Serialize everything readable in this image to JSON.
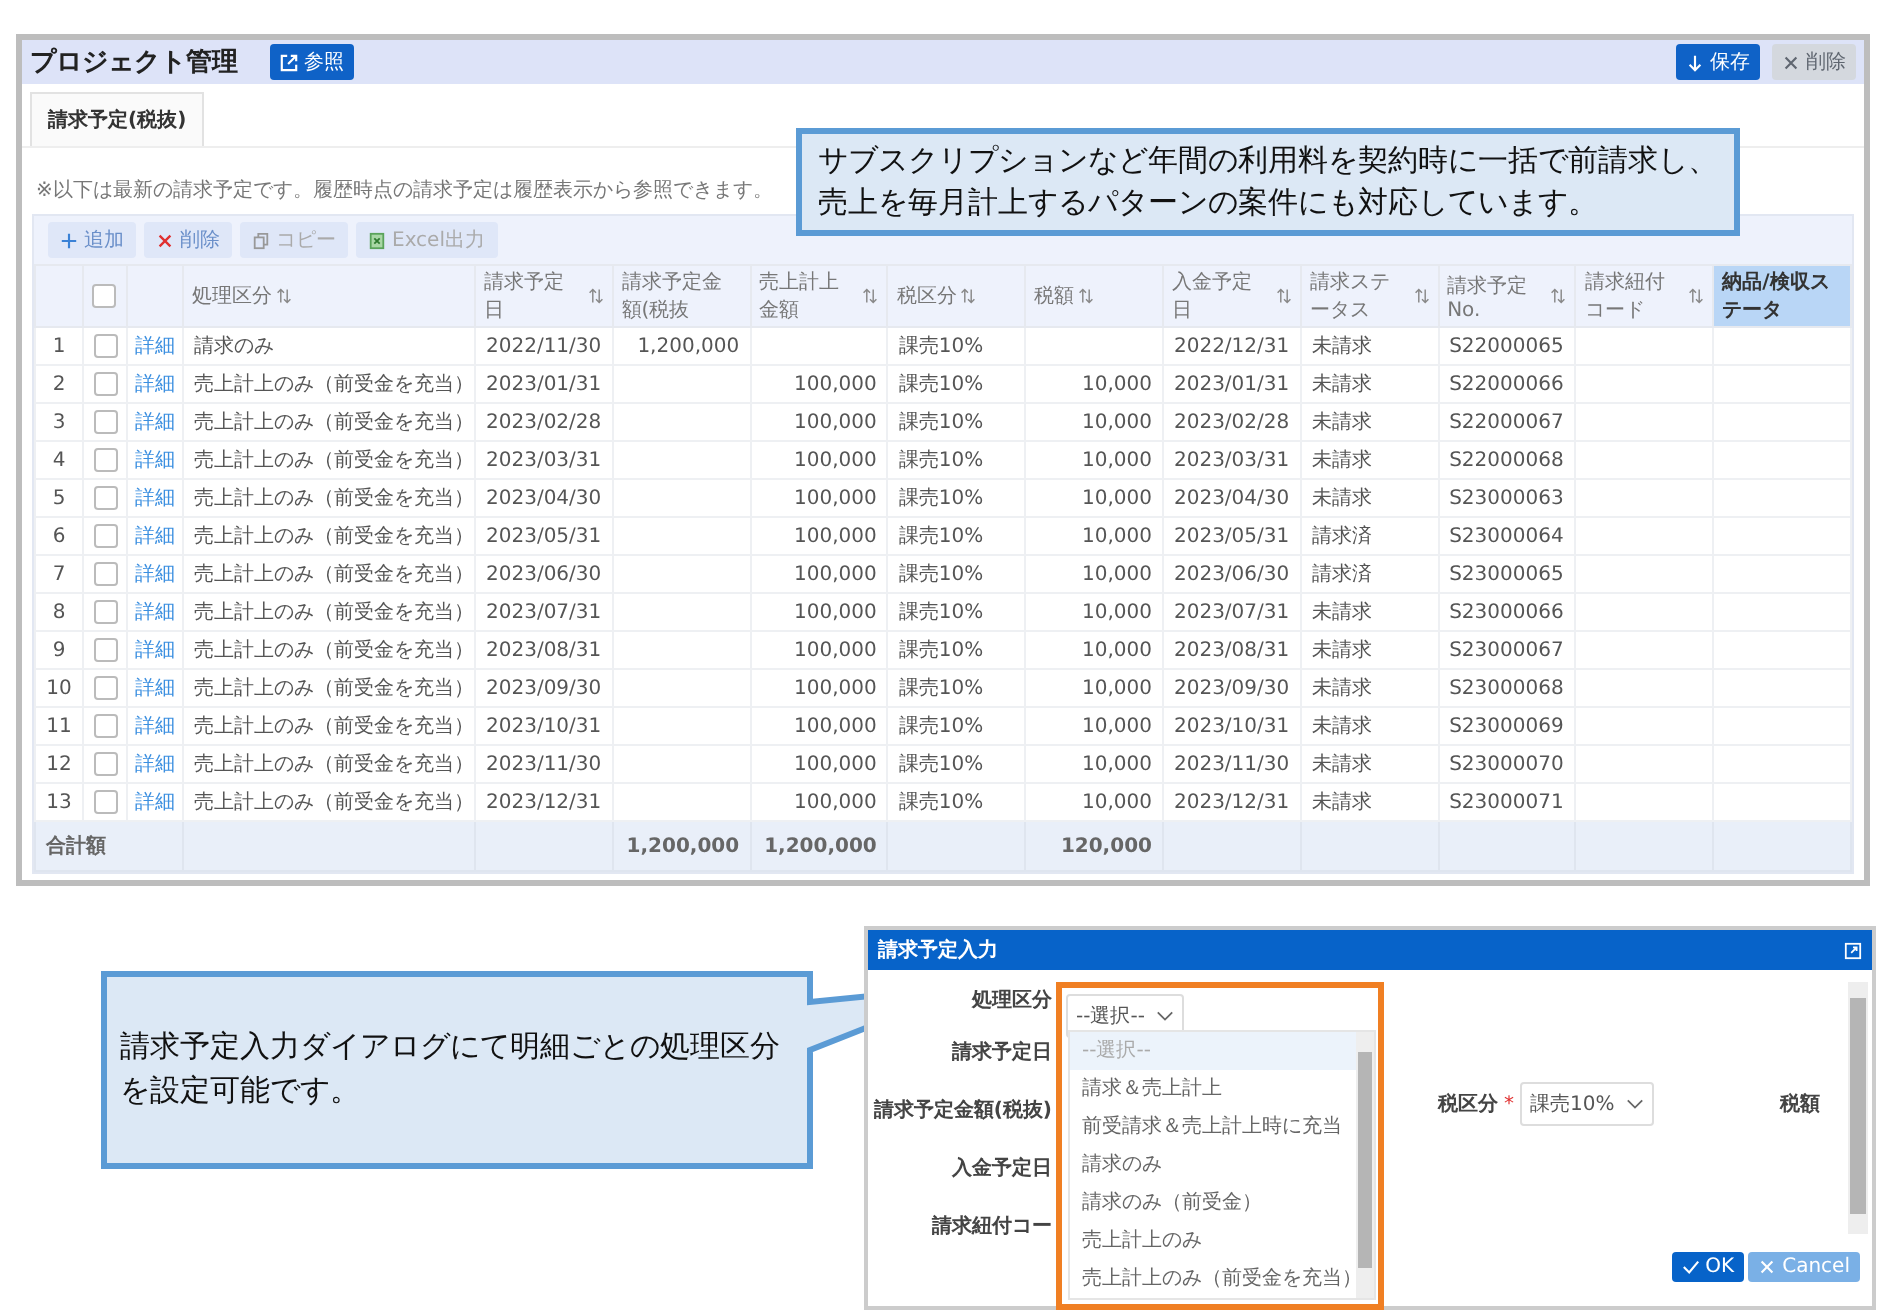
{
  "app": {
    "title": "プロジェクト管理",
    "reference_button": "参照",
    "save_button": "保存",
    "delete_button": {
      "label": "削除",
      "disabled": true
    }
  },
  "tabs": [
    {
      "label": "請求予定(税抜)",
      "selected": true
    }
  ],
  "note": "※以下は最新の請求予定です。履歴時点の請求予定は履歴表示から参照できます。",
  "toolbar": [
    {
      "kind": "add",
      "label": "追加",
      "disabled": false
    },
    {
      "kind": "delete",
      "label": "削除",
      "disabled": false
    },
    {
      "kind": "copy",
      "label": "コピー",
      "disabled": true
    },
    {
      "kind": "excel",
      "label": "Excel出力",
      "disabled": true
    }
  ],
  "table": {
    "header_checkbox": {
      "checked": false
    },
    "columns": [
      {
        "label": "処理区分",
        "sortable": true,
        "highlighted": false
      },
      {
        "label": "請求予定日",
        "sortable": true,
        "highlighted": false
      },
      {
        "label": "請求予定金額(税抜",
        "sortable": false,
        "highlighted": false
      },
      {
        "label": "売上計上金額",
        "sortable": true,
        "highlighted": false
      },
      {
        "label": "税区分",
        "sortable": true,
        "highlighted": false
      },
      {
        "label": "税額",
        "sortable": true,
        "highlighted": false
      },
      {
        "label": "入金予定日",
        "sortable": true,
        "highlighted": false
      },
      {
        "label": "請求ステータス",
        "sortable": true,
        "highlighted": false
      },
      {
        "label": "請求予定No.",
        "sortable": true,
        "highlighted": false
      },
      {
        "label": "請求紐付コード",
        "sortable": true,
        "highlighted": false
      },
      {
        "label": "納品/検収ステータ",
        "sortable": false,
        "highlighted": true
      }
    ],
    "rows": [
      {
        "no": "1",
        "checked": false,
        "link": "詳細",
        "cells": [
          "請求のみ",
          "2022/11/30",
          "1,200,000",
          "",
          "課売10%",
          "",
          "2022/12/31",
          "未請求",
          "S22000065",
          "",
          ""
        ]
      },
      {
        "no": "2",
        "checked": false,
        "link": "詳細",
        "cells": [
          "売上計上のみ（前受金を充当）",
          "2023/01/31",
          "",
          "100,000",
          "課売10%",
          "10,000",
          "2023/01/31",
          "未請求",
          "S22000066",
          "",
          ""
        ]
      },
      {
        "no": "3",
        "checked": false,
        "link": "詳細",
        "cells": [
          "売上計上のみ（前受金を充当）",
          "2023/02/28",
          "",
          "100,000",
          "課売10%",
          "10,000",
          "2023/02/28",
          "未請求",
          "S22000067",
          "",
          ""
        ]
      },
      {
        "no": "4",
        "checked": false,
        "link": "詳細",
        "cells": [
          "売上計上のみ（前受金を充当）",
          "2023/03/31",
          "",
          "100,000",
          "課売10%",
          "10,000",
          "2023/03/31",
          "未請求",
          "S22000068",
          "",
          ""
        ]
      },
      {
        "no": "5",
        "checked": false,
        "link": "詳細",
        "cells": [
          "売上計上のみ（前受金を充当）",
          "2023/04/30",
          "",
          "100,000",
          "課売10%",
          "10,000",
          "2023/04/30",
          "未請求",
          "S23000063",
          "",
          ""
        ]
      },
      {
        "no": "6",
        "checked": false,
        "link": "詳細",
        "cells": [
          "売上計上のみ（前受金を充当）",
          "2023/05/31",
          "",
          "100,000",
          "課売10%",
          "10,000",
          "2023/05/31",
          "請求済",
          "S23000064",
          "",
          ""
        ]
      },
      {
        "no": "7",
        "checked": false,
        "link": "詳細",
        "cells": [
          "売上計上のみ（前受金を充当）",
          "2023/06/30",
          "",
          "100,000",
          "課売10%",
          "10,000",
          "2023/06/30",
          "請求済",
          "S23000065",
          "",
          ""
        ]
      },
      {
        "no": "8",
        "checked": false,
        "link": "詳細",
        "cells": [
          "売上計上のみ（前受金を充当）",
          "2023/07/31",
          "",
          "100,000",
          "課売10%",
          "10,000",
          "2023/07/31",
          "未請求",
          "S23000066",
          "",
          ""
        ]
      },
      {
        "no": "9",
        "checked": false,
        "link": "詳細",
        "cells": [
          "売上計上のみ（前受金を充当）",
          "2023/08/31",
          "",
          "100,000",
          "課売10%",
          "10,000",
          "2023/08/31",
          "未請求",
          "S23000067",
          "",
          ""
        ]
      },
      {
        "no": "10",
        "checked": false,
        "link": "詳細",
        "cells": [
          "売上計上のみ（前受金を充当）",
          "2023/09/30",
          "",
          "100,000",
          "課売10%",
          "10,000",
          "2023/09/30",
          "未請求",
          "S23000068",
          "",
          ""
        ]
      },
      {
        "no": "11",
        "checked": false,
        "link": "詳細",
        "cells": [
          "売上計上のみ（前受金を充当）",
          "2023/10/31",
          "",
          "100,000",
          "課売10%",
          "10,000",
          "2023/10/31",
          "未請求",
          "S23000069",
          "",
          ""
        ]
      },
      {
        "no": "12",
        "checked": false,
        "link": "詳細",
        "cells": [
          "売上計上のみ（前受金を充当）",
          "2023/11/30",
          "",
          "100,000",
          "課売10%",
          "10,000",
          "2023/11/30",
          "未請求",
          "S23000070",
          "",
          ""
        ]
      },
      {
        "no": "13",
        "checked": false,
        "link": "詳細",
        "cells": [
          "売上計上のみ（前受金を充当）",
          "2023/12/31",
          "",
          "100,000",
          "課売10%",
          "10,000",
          "2023/12/31",
          "未請求",
          "S23000071",
          "",
          ""
        ]
      }
    ],
    "totals": {
      "label": "合計額",
      "cells": [
        "",
        "",
        "1,200,000",
        "1,200,000",
        "",
        "120,000",
        "",
        "",
        "",
        "",
        ""
      ]
    }
  },
  "callouts": [
    {
      "kind": "top",
      "text_lines": [
        "サブスクリプションなど年間の利用料を契約時に一括で前請求し、",
        "売上を毎月計上するパターンの案件にも対応しています。"
      ]
    },
    {
      "kind": "left",
      "text": "請求予定入力ダイアログにて明細ごとの処理区分を設定可能です。"
    }
  ],
  "dialog": {
    "title": "請求予定入力",
    "fields": [
      {
        "label": "処理区分"
      },
      {
        "label": "請求予定日"
      },
      {
        "label": "請求予定金額(税抜)"
      },
      {
        "label": "入金予定日"
      },
      {
        "label": "請求紐付コー"
      }
    ],
    "type_select": "--選択--",
    "tax_label": "税区分",
    "required_mark": "*",
    "tax_select": "課売10%",
    "tax_amount_label": "税額",
    "options": [
      {
        "label": "--選択--",
        "selected": true
      },
      {
        "label": "請求＆売上計上",
        "selected": false
      },
      {
        "label": "前受請求＆売上計上時に充当",
        "selected": false
      },
      {
        "label": "請求のみ",
        "selected": false
      },
      {
        "label": "請求のみ（前受金）",
        "selected": false
      },
      {
        "label": "売上計上のみ",
        "selected": false
      },
      {
        "label": "売上計上のみ（前受金を充当）",
        "selected": false
      }
    ],
    "ok_button": "OK",
    "cancel_button": "Cancel"
  }
}
